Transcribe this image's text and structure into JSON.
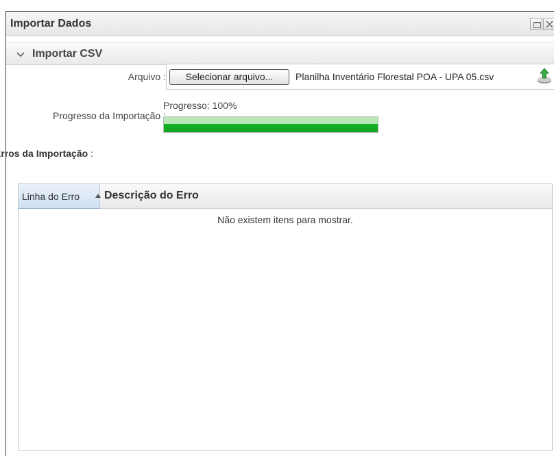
{
  "window": {
    "title": "Importar Dados"
  },
  "section": {
    "title": "Importar CSV"
  },
  "form": {
    "arquivo_label": "Arquivo :",
    "select_button_label": "Selecionar arquivo...",
    "file_name": "Planilha Inventário Florestal POA - UPA 05.csv",
    "progress_label": "Progresso da Importação :",
    "progress_text": "Progresso: 100%",
    "progress_value": 1.0
  },
  "errors": {
    "label": "Erros da Importação",
    "label_suffix": " :",
    "columns": [
      "Linha do Erro",
      "Descrição do Erro"
    ],
    "empty_message": "Não existem itens para mostrar."
  },
  "icons": {
    "window_restore": "restore-window-icon",
    "window_close": "close-icon",
    "section_toggle": "chevron-down-icon",
    "upload": "upload-icon",
    "sort": "sort-asc-icon"
  },
  "colors": {
    "progress_green": "#16b326",
    "header_selected": "#cfe0f3"
  }
}
